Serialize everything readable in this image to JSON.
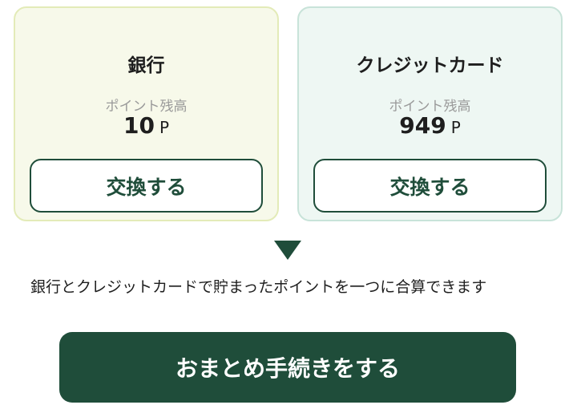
{
  "cards": {
    "bank": {
      "title": "銀行",
      "balance_label": "ポイント残高",
      "balance_value": "10",
      "balance_unit": "P",
      "button_label": "交換する"
    },
    "credit": {
      "title": "クレジットカード",
      "balance_label": "ポイント残高",
      "balance_value": "949",
      "balance_unit": "P",
      "button_label": "交換する"
    }
  },
  "arrow_icon": "down-triangle-icon",
  "description": "銀行とクレジットカードで貯まったポイントを一つに合算できます",
  "consolidate_button_label": "おまとめ手続きをする",
  "colors": {
    "primary": "#1f4d3a",
    "bank_card_bg": "#f7f9ea",
    "credit_card_bg": "#eef7f3"
  }
}
